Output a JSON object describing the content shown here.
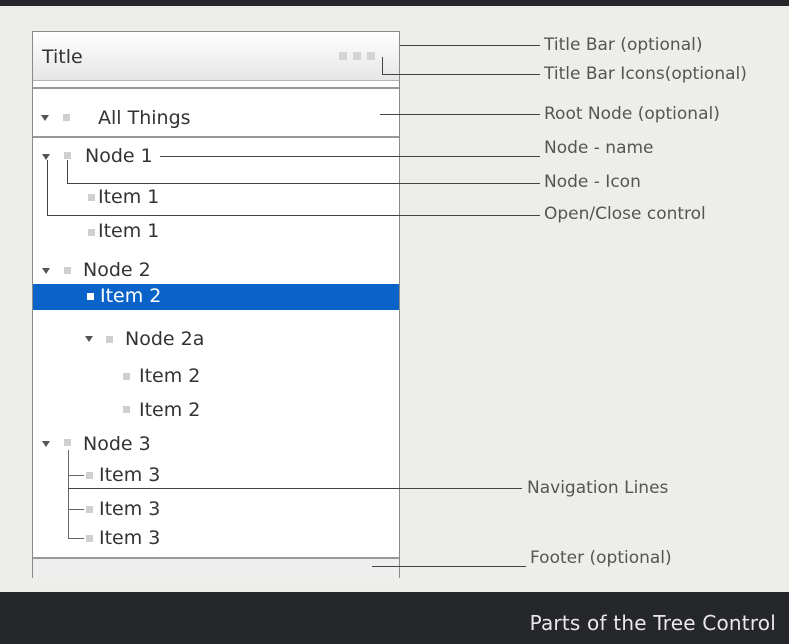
{
  "caption": "Parts of the Tree Control",
  "tree": {
    "title": "Title",
    "title_icons": [
      "window-control-icon",
      "window-control-icon",
      "window-control-icon"
    ],
    "root": "All Things",
    "nodes": {
      "node1": "Node 1",
      "node1_item_a": "Item 1",
      "node1_item_b": "Item 1",
      "node2": "Node 2",
      "node2_item_selected": "Item 2",
      "node2a": "Node 2a",
      "node2a_item_a": "Item 2",
      "node2a_item_b": "Item 2",
      "node3": "Node 3",
      "node3_item_a": "Item 3",
      "node3_item_b": "Item 3",
      "node3_item_c": "Item 3"
    },
    "colors": {
      "selection": "#0a63c9",
      "footer_band": "#26272b"
    }
  },
  "labels": {
    "title_bar": "Title Bar (optional)",
    "title_bar_icons": "Title Bar Icons(optional)",
    "root_node": "Root Node (optional)",
    "node_name": "Node - name",
    "node_icon": "Node - Icon",
    "open_close": "Open/Close control",
    "nav_lines": "Navigation Lines",
    "footer": "Footer (optional)"
  }
}
